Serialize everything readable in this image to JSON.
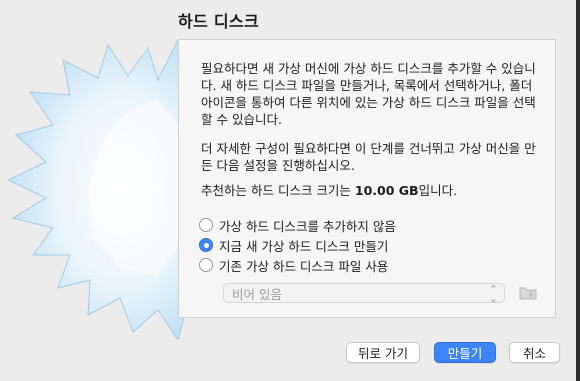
{
  "dialog": {
    "title": "하드 디스크",
    "paragraphs": {
      "p1": "필요하다면 새 가상 머신에 가상 하드 디스크를 추가할 수 있습니다. 새 하드 디스크 파일을 만들거나, 목록에서 선택하거나, 폴더 아이콘을 통하여 다른 위치에 있는 가상 하드 디스크 파일을 선택할 수 있습니다.",
      "p2": "더 자세한 구성이 필요하다면 이 단계를 건너뛰고 가상 머신을 만든 다음 설정을 진행하십시오.",
      "p3_prefix": "추천하는 하드 디스크 크기는 ",
      "p3_size": "10.00 GB",
      "p3_suffix": "입니다."
    },
    "options": [
      {
        "label": "가상 하드 디스크를 추가하지 않음",
        "selected": false
      },
      {
        "label": "지금 새 가상 하드 디스크 만들기",
        "selected": true
      },
      {
        "label": "기존 가상 하드 디스크 파일 사용",
        "selected": false
      }
    ],
    "disk_select": {
      "value": "비어 있음",
      "icon": "chevron-updown-icon"
    },
    "folder_icon": "folder-icon",
    "buttons": {
      "back": "뒤로 가기",
      "create": "만들기",
      "cancel": "취소"
    }
  },
  "colors": {
    "accent": "#3d84f7",
    "window_bg": "#ececec",
    "panel_bg": "#f6f6f6",
    "art_light": "#e9f4fb",
    "art_mid": "#b9dcf2"
  }
}
